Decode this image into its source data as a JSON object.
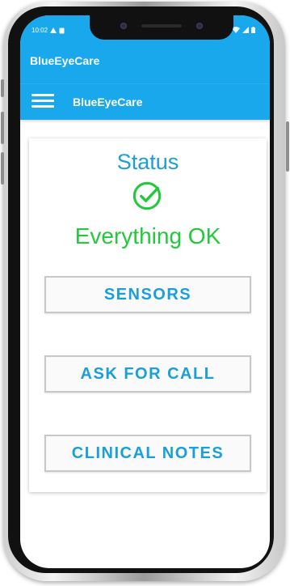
{
  "status_bar": {
    "time": "10:02",
    "left_icons": [
      "navigation-icon",
      "sim-icon"
    ],
    "right_icons": [
      "wifi-icon",
      "signal-icon",
      "battery-icon"
    ]
  },
  "app_bar": {
    "app_name": "BlueEyeCare"
  },
  "toolbar": {
    "title": "BlueEyeCare",
    "menu_icon": "hamburger-menu-icon"
  },
  "status_card": {
    "heading": "Status",
    "status_icon": "check-circle-icon",
    "status_text": "Everything OK"
  },
  "actions": {
    "sensors_label": "SENSORS",
    "ask_for_call_label": "ASK FOR CALL",
    "clinical_notes_label": "CLINICAL NOTES"
  },
  "colors": {
    "primary": "#1aa8ec",
    "accent_text": "#1a9fd8",
    "ok_green": "#22c93a"
  }
}
